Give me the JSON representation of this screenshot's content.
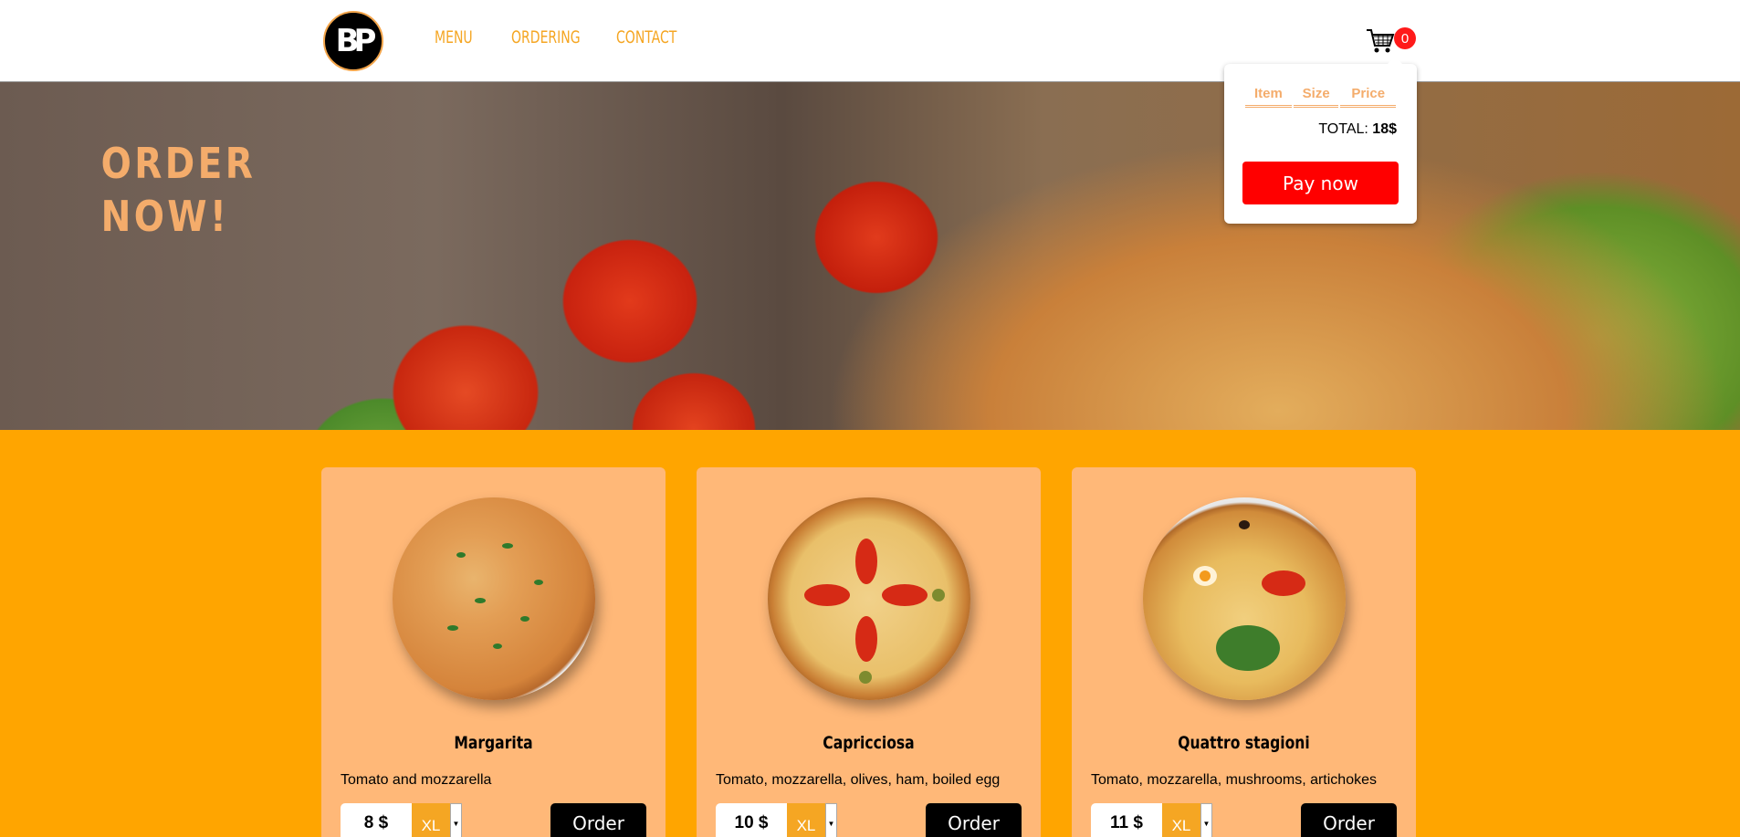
{
  "header": {
    "logo_text": "BP",
    "nav": [
      "MENU",
      "ORDERING",
      "CONTACT"
    ],
    "cart_count": "0"
  },
  "hero": {
    "title_line1": "ORDER",
    "title_line2": "NOW!"
  },
  "cart_popup": {
    "columns": [
      "Item",
      "Size",
      "Price"
    ],
    "total_label": "TOTAL:",
    "total_value": "18$",
    "pay_label": "Pay now"
  },
  "pizzas": [
    {
      "name": "Margarita",
      "description": "Tomato and mozzarella",
      "price": "8 $",
      "size": "XL",
      "order_label": "Order"
    },
    {
      "name": "Capricciosa",
      "description": "Tomato, mozzarella, olives, ham, boiled egg",
      "price": "10 $",
      "size": "XL",
      "order_label": "Order"
    },
    {
      "name": "Quattro stagioni",
      "description": "Tomato, mozzarella, mushrooms, artichokes",
      "price": "11 $",
      "size": "XL",
      "order_label": "Order"
    }
  ],
  "colors": {
    "accent": "#ffa500",
    "card": "#ffb878",
    "nav": "#f5a623",
    "pay": "#ff0000"
  }
}
